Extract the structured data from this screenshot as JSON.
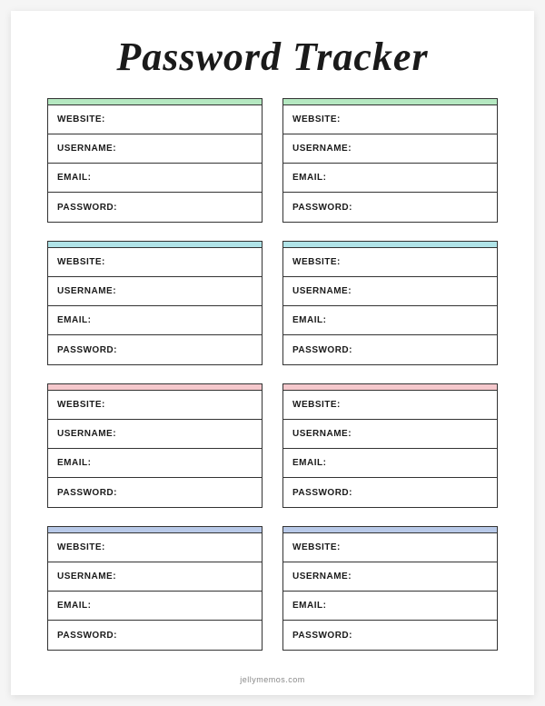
{
  "title": "Password Tracker",
  "footer": "jellymemos.com",
  "labels": {
    "website": "WEBSITE:",
    "username": "USERNAME:",
    "email": "EMAIL:",
    "password": "PASSWORD:"
  },
  "colors": {
    "green": "#b5e8c1",
    "cyan": "#b0e4e8",
    "pink": "#f5c8cc",
    "blue": "#b8c9e8"
  },
  "cards": [
    {
      "accent": "green"
    },
    {
      "accent": "green"
    },
    {
      "accent": "cyan"
    },
    {
      "accent": "cyan"
    },
    {
      "accent": "pink"
    },
    {
      "accent": "pink"
    },
    {
      "accent": "blue"
    },
    {
      "accent": "blue"
    }
  ]
}
